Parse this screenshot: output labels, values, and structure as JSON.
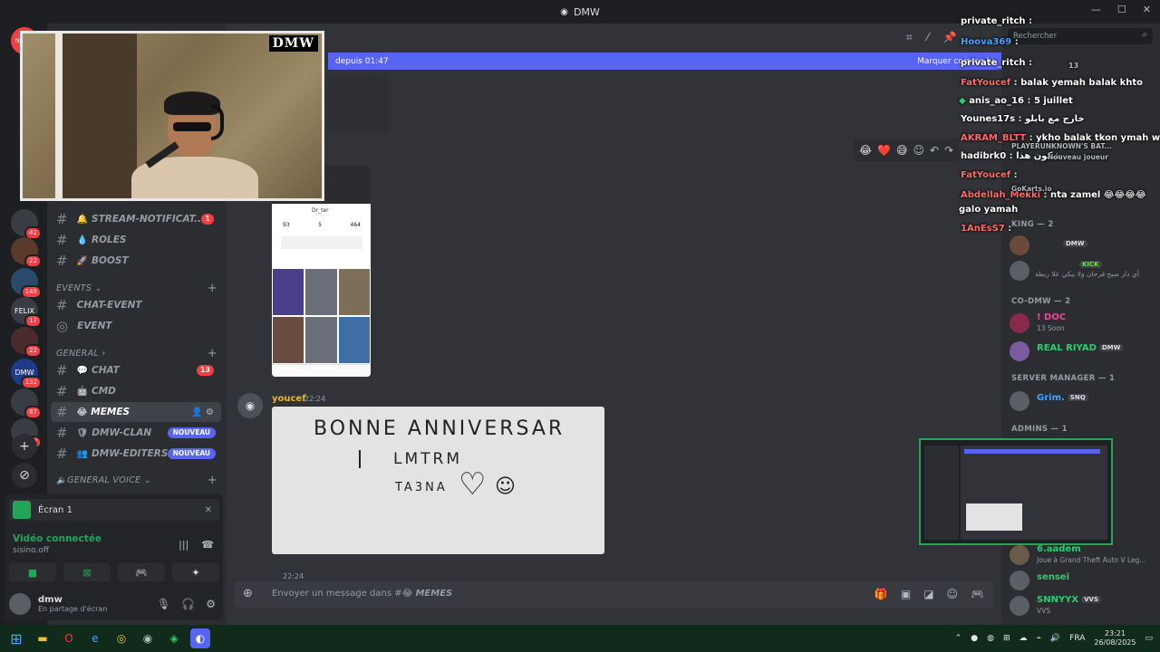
{
  "window": {
    "title": "DMW"
  },
  "banner": {
    "since": "depuis 01:47",
    "mark_read": "Marquer comme lu"
  },
  "servers": [
    {
      "label": "NOTIF",
      "badge": ""
    },
    {
      "label": "",
      "badge": "42"
    },
    {
      "label": "",
      "badge": "22"
    },
    {
      "label": "",
      "badge": "146"
    },
    {
      "label": "FELIX",
      "badge": "17"
    },
    {
      "label": "",
      "badge": "22"
    },
    {
      "label": "DMW",
      "badge": "132"
    },
    {
      "label": "",
      "badge": "87"
    },
    {
      "label": "",
      "badge": "17"
    }
  ],
  "channels": {
    "stream_notif": {
      "name": "STREAM-NOTIFICAT...",
      "count": "1"
    },
    "roles": {
      "name": "ROLES"
    },
    "boost": {
      "name": "BOOST"
    },
    "events_category": "EVENTS",
    "chat_event": {
      "name": "CHAT-EVENT"
    },
    "event": {
      "name": "EVENT"
    },
    "general_category": "GENERAL",
    "chat": {
      "name": "CHAT",
      "count": "13"
    },
    "cmd": {
      "name": "CMD"
    },
    "memes": {
      "name": "MEMES"
    },
    "dmw_clan": {
      "name": "DMW-CLAN",
      "badge": "NOUVEAU"
    },
    "dmw_editers": {
      "name": "DMW-EDITERS",
      "badge": "NOUVEAU"
    },
    "general_voice": "GENERAL VOICE"
  },
  "voice": {
    "screen_label": "Écran 1",
    "status": "Vidéo connectée",
    "server": "sisino.off",
    "user": "dmw",
    "user_status": "En partage d'écran"
  },
  "webcam": {
    "watermark": "DMW"
  },
  "message": {
    "author": "youcef",
    "time": "22:24",
    "next_time": "22:24"
  },
  "drawing": {
    "line1": "BONNE ANNIVERSAR",
    "line2": "LMTRM",
    "line3": "TA3NA"
  },
  "phone": {
    "profile": "Dr_ter",
    "stat1": "93",
    "stat2": "5",
    "stat3": "464"
  },
  "composer": {
    "placeholder": "Envoyer un message dans #",
    "channel": "MEMES"
  },
  "search": {
    "placeholder": "Rechercher"
  },
  "members": {
    "king_group": "KING — 2",
    "codmw_group": "CO-DMW — 2",
    "server_manager_group": "SERVER MANAGER — 1",
    "admins_group": "ADMINS — 1",
    "m1_tag": "DMW",
    "m2_tag": "KICK",
    "m2_sub": "أي دار صبح فرحان ولا يبكي علا ربطة",
    "doc": {
      "name": "! DOC",
      "sub": "13 Soon"
    },
    "riyad": {
      "name": "REAL RIYAD",
      "tag": "DMW"
    },
    "grim": {
      "name": "Grim.",
      "tag": "SNQ"
    },
    "aadem": {
      "name": "6.aadem",
      "sub": "Joue à Grand Theft Auto V Leg..."
    },
    "sensei": {
      "name": "sensei"
    },
    "snnyyx": {
      "name": "SNNYYX",
      "tag": "VVS",
      "sub": "VVS"
    }
  },
  "stream_chat": [
    {
      "user": "private_ritch",
      "color": "#ffffff",
      "text": ""
    },
    {
      "user": "Hoova369",
      "color": "#4aa3ff",
      "text": ""
    },
    {
      "user": "private_ritch",
      "color": "#ffffff",
      "text": ""
    },
    {
      "user": "FatYoucef",
      "color": "#ff6b6b",
      "text": "balak yemah balak khto"
    },
    {
      "user": "anis_ao_16",
      "color": "#ffffff",
      "text": "5 juillet"
    },
    {
      "user": "Younes17s",
      "color": "#ffffff",
      "text": "خارج مع بابلو"
    },
    {
      "user": "AKRAM_BLTT",
      "color": "#ff6b6b",
      "text": "ykho balak tkon ymah wla"
    },
    {
      "user": "hadibrk0",
      "color": "#ffffff",
      "text": "شكون هذا"
    },
    {
      "user": "FatYoucef",
      "color": "#ff6b6b",
      "text": ""
    },
    {
      "user": "Abdellah_Mekki",
      "color": "#ff6b6b",
      "text": "nta zamel 😂😂😂😂"
    },
    {
      "user": "galo yamah",
      "color": "#ffffff",
      "text": ""
    },
    {
      "user": "1AnEsS7",
      "color": "#ff6b6b",
      "text": ""
    }
  ],
  "overlay_extra": {
    "count": "13",
    "games": "PLAYERUNKNOWN'S BAT...",
    "new_player": "Nouveau joueur",
    "gokarts": "GoKarts.io"
  },
  "taskbar": {
    "lang": "FRA",
    "time": "23:21",
    "date": "26/08/2025"
  }
}
